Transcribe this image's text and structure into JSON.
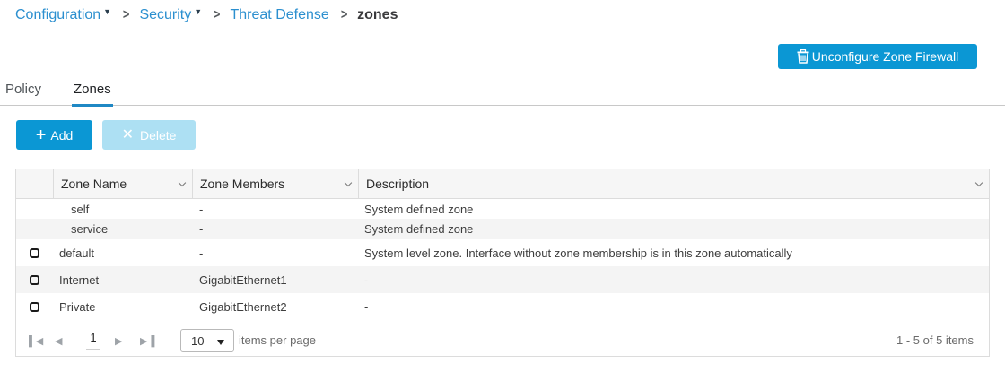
{
  "breadcrumb": {
    "items": [
      {
        "label": "Configuration",
        "dropdown": true
      },
      {
        "label": "Security",
        "dropdown": true
      },
      {
        "label": "Threat Defense",
        "dropdown": false
      }
    ],
    "current": "zones",
    "separator": ">"
  },
  "toolbar": {
    "unconfigure_label": "Unconfigure Zone Firewall",
    "unconfigure_icon": "trash-icon"
  },
  "tabs": [
    {
      "label": "Policy",
      "active": false
    },
    {
      "label": "Zones",
      "active": true
    }
  ],
  "actions": {
    "add_label": "Add",
    "add_icon": "plus-icon",
    "delete_label": "Delete",
    "delete_icon": "close-icon",
    "delete_enabled": false
  },
  "table": {
    "columns": [
      "Zone Name",
      "Zone Members",
      "Description"
    ],
    "rows": [
      {
        "name": "self",
        "members": "-",
        "description": "System defined zone",
        "selectable": false
      },
      {
        "name": "service",
        "members": "-",
        "description": "System defined zone",
        "selectable": false
      },
      {
        "name": "default",
        "members": "-",
        "description": "System level zone. Interface without zone membership is in this zone automatically",
        "selectable": true
      },
      {
        "name": "Internet",
        "members": "GigabitEthernet1",
        "description": "-",
        "selectable": true
      },
      {
        "name": "Private",
        "members": "GigabitEthernet2",
        "description": "-",
        "selectable": true
      }
    ]
  },
  "pager": {
    "page": "1",
    "page_size": "10",
    "page_size_label": "items per page",
    "count_text": "1 - 5 of 5 items"
  },
  "colors": {
    "primary": "#0b97d4",
    "disabled": "#ade0f3",
    "link": "#2b8fcf"
  }
}
